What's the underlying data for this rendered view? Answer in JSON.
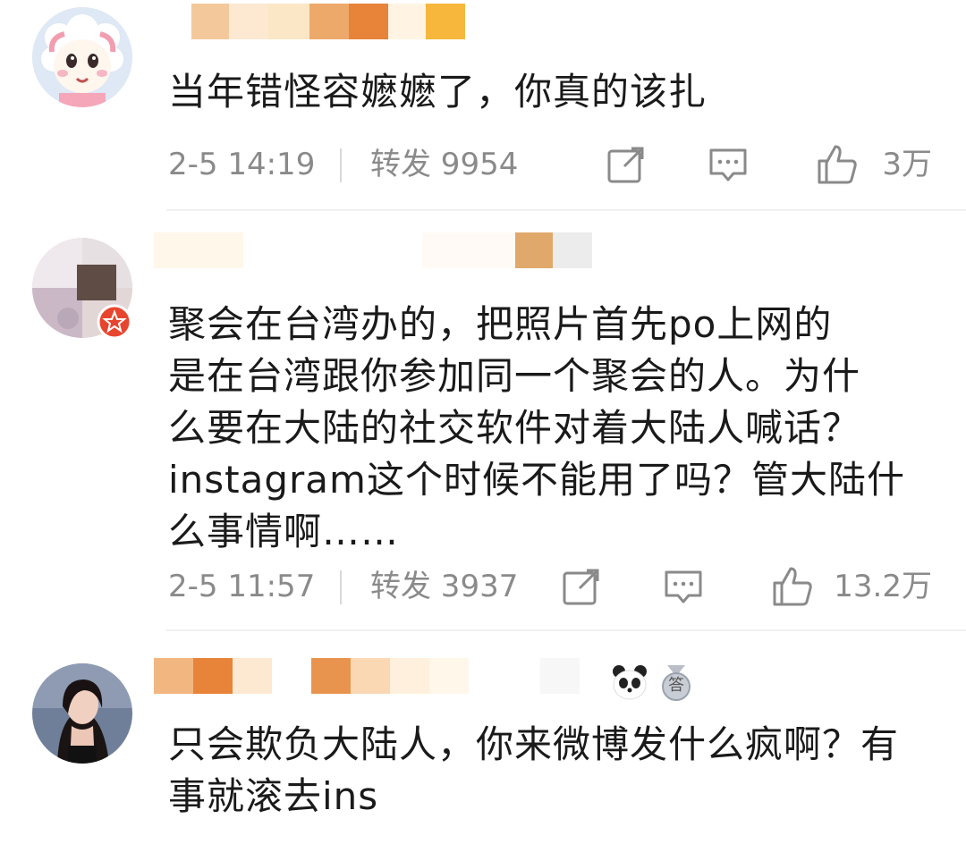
{
  "comments": [
    {
      "text": "当年错怪容嬷嬷了，你真的该扎",
      "time": "2-5 14:19",
      "forward": "转发 9954",
      "likes": "3万",
      "avatar_icon": "cartoon-sheep-avatar"
    },
    {
      "text": "聚会在台湾办的，把照片首先po上网的\n是在台湾跟你参加同一个聚会的人。为什\n么要在大陆的社交软件对着大陆人喊话？\ninstagram这个时候不能用了吗？管大陆什\n么事情啊……",
      "time": "2-5 11:57",
      "forward": "转发 3937",
      "likes": "13.2万",
      "avatar_icon": "blurred-photo-avatar"
    },
    {
      "text": "只会欺负大陆人，你来微博发什么疯啊？有\n事就滚去ins",
      "avatar_icon": "woman-photo-avatar",
      "badge_label": "答"
    }
  ],
  "colors": {
    "text": "#1a1a1a",
    "meta": "#8a8a8a",
    "mosaic_orange": "#e8833a",
    "mosaic_tan": "#e0a86a",
    "mosaic_pale": "#fbe5c8"
  }
}
